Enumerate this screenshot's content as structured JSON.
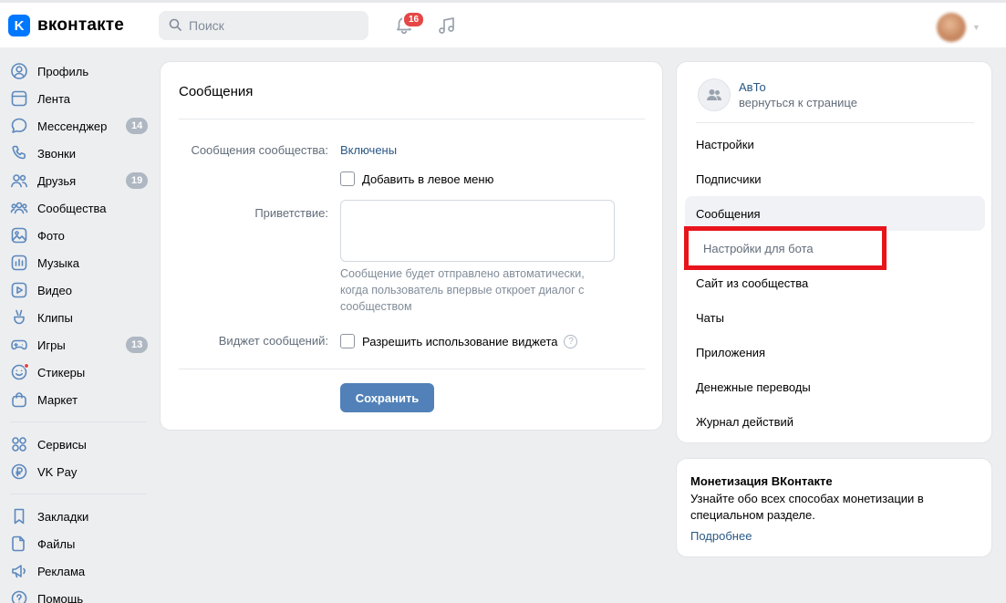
{
  "header": {
    "logo_text": "вконтакте",
    "logo_letter": "K",
    "search_placeholder": "Поиск",
    "notifications_count": "16"
  },
  "nav": {
    "items": [
      {
        "id": "profile",
        "label": "Профиль",
        "icon": "user-icon"
      },
      {
        "id": "feed",
        "label": "Лента",
        "icon": "feed-icon"
      },
      {
        "id": "messenger",
        "label": "Мессенджер",
        "icon": "chat-icon",
        "count": "14"
      },
      {
        "id": "calls",
        "label": "Звонки",
        "icon": "phone-icon"
      },
      {
        "id": "friends",
        "label": "Друзья",
        "icon": "friends-icon",
        "count": "19"
      },
      {
        "id": "communities",
        "label": "Сообщества",
        "icon": "communities-icon"
      },
      {
        "id": "photos",
        "label": "Фото",
        "icon": "photo-icon"
      },
      {
        "id": "music",
        "label": "Музыка",
        "icon": "music-icon"
      },
      {
        "id": "video",
        "label": "Видео",
        "icon": "video-icon"
      },
      {
        "id": "clips",
        "label": "Клипы",
        "icon": "clips-icon"
      },
      {
        "id": "games",
        "label": "Игры",
        "icon": "gamepad-icon",
        "count": "13"
      },
      {
        "id": "stickers",
        "label": "Стикеры",
        "icon": "smile-icon"
      },
      {
        "id": "market",
        "label": "Маркет",
        "icon": "bag-icon"
      }
    ],
    "items2": [
      {
        "id": "services",
        "label": "Сервисы",
        "icon": "grid-icon"
      },
      {
        "id": "vkpay",
        "label": "VK Pay",
        "icon": "ruble-icon"
      }
    ],
    "items3": [
      {
        "id": "bookmarks",
        "label": "Закладки",
        "icon": "bookmark-icon"
      },
      {
        "id": "files",
        "label": "Файлы",
        "icon": "file-icon"
      },
      {
        "id": "ads",
        "label": "Реклама",
        "icon": "megaphone-icon"
      },
      {
        "id": "help",
        "label": "Помощь",
        "icon": "help-icon"
      }
    ]
  },
  "main": {
    "title": "Сообщения",
    "community_messages_label": "Сообщения сообщества:",
    "community_messages_value": "Включены",
    "add_left_menu_label": "Добавить в левое меню",
    "greeting_label": "Приветствие:",
    "greeting_value": "",
    "greeting_hint": "Сообщение будет отправлено автоматически, когда пользователь впервые откроет диалог с сообществом",
    "widget_label": "Виджет сообщений:",
    "widget_checkbox_label": "Разрешить использование виджета",
    "help_glyph": "?",
    "save_label": "Сохранить"
  },
  "right_menu": {
    "community_name": "АвТо",
    "back_link": "вернуться к странице",
    "items": [
      {
        "label": "Настройки"
      },
      {
        "label": "Подписчики"
      },
      {
        "label": "Сообщения",
        "active": true
      },
      {
        "label": "Настройки для бота",
        "sub": true
      },
      {
        "label": "Сайт из сообщества"
      },
      {
        "label": "Чаты"
      },
      {
        "label": "Приложения"
      },
      {
        "label": "Денежные переводы"
      },
      {
        "label": "Журнал действий"
      }
    ]
  },
  "monetization": {
    "title": "Монетизация ВКонтакте",
    "text": "Узнайте обо всех способах монетизации в специальном разделе.",
    "link": "Подробнее"
  },
  "colors": {
    "accent": "#0077ff",
    "link": "#2a5885",
    "button": "#5181b8",
    "highlight": "#e8141c",
    "badge": "#aeb7c2",
    "notif_badge": "#e64646"
  }
}
